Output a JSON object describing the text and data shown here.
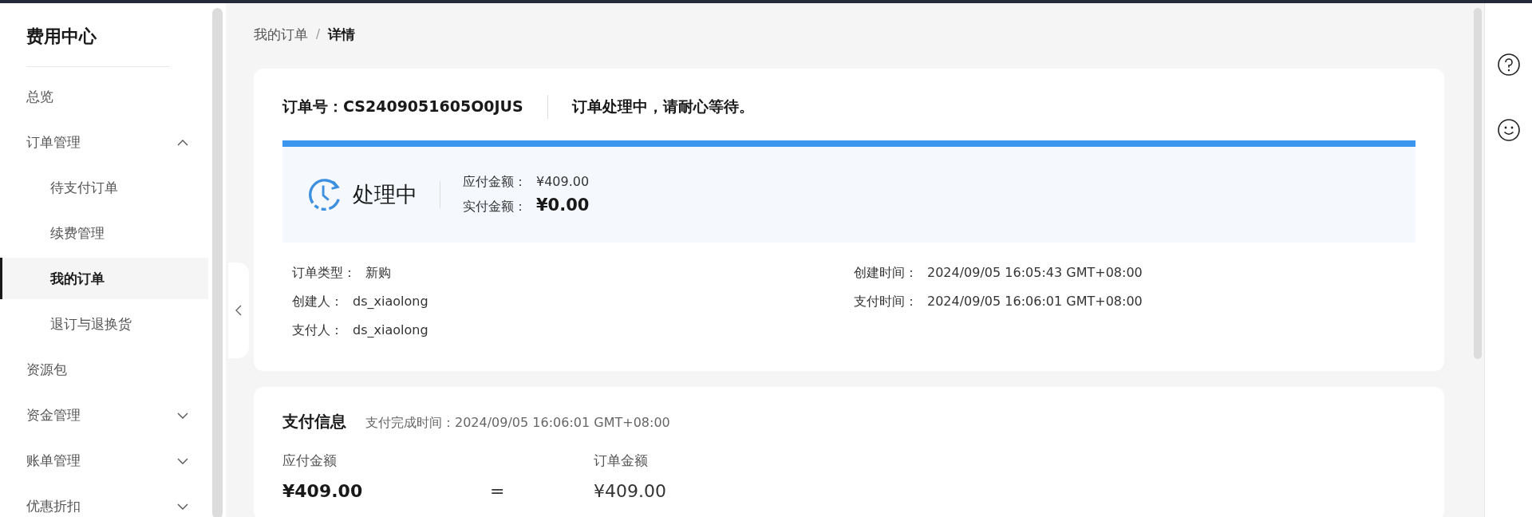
{
  "sidebar": {
    "title": "费用中心",
    "items": [
      {
        "label": "总览",
        "selected": false
      },
      {
        "label": "订单管理",
        "selected": false,
        "expanded": true,
        "children": [
          {
            "label": "待支付订单",
            "selected": false
          },
          {
            "label": "续费管理",
            "selected": false
          },
          {
            "label": "我的订单",
            "selected": true
          },
          {
            "label": "退订与退换货",
            "selected": false
          }
        ]
      },
      {
        "label": "资源包",
        "selected": false
      },
      {
        "label": "资金管理",
        "selected": false,
        "expanded": false
      },
      {
        "label": "账单管理",
        "selected": false,
        "expanded": false
      },
      {
        "label": "优惠折扣",
        "selected": false,
        "expanded": false
      }
    ]
  },
  "breadcrumb": {
    "separator": "/",
    "items": [
      {
        "label": "我的订单"
      },
      {
        "label": "详情"
      }
    ]
  },
  "order": {
    "number_label": "订单号：",
    "number": "CS2409051605O0JUS",
    "message": "订单处理中，请耐心等待。",
    "status": "处理中",
    "amounts": [
      {
        "label": "应付金额：",
        "value": "¥409.00",
        "emphasis": false
      },
      {
        "label": "实付金额：",
        "value": "¥0.00",
        "emphasis": true
      }
    ],
    "details_left": [
      {
        "label": "订单类型：",
        "value": "新购"
      },
      {
        "label": "创建人：",
        "value": "ds_xiaolong"
      },
      {
        "label": "支付人：",
        "value": "ds_xiaolong"
      }
    ],
    "details_right": [
      {
        "label": "创建时间：",
        "value": "2024/09/05 16:05:43 GMT+08:00"
      },
      {
        "label": "支付时间：",
        "value": "2024/09/05 16:06:01 GMT+08:00"
      }
    ]
  },
  "payment": {
    "title": "支付信息",
    "completed": "支付完成时间：2024/09/05 16:06:01 GMT+08:00",
    "payable_label": "应付金额",
    "payable": "¥409.00",
    "operator": "=",
    "order_label": "订单金额",
    "order_amount": "¥409.00"
  }
}
